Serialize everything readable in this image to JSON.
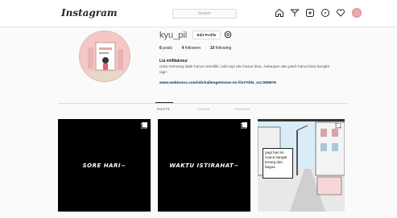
{
  "app": {
    "logo": "Instagram",
    "search_placeholder": "Search"
  },
  "nav_icons": [
    "home-icon",
    "direct-icon",
    "new-post-icon",
    "explore-icon",
    "activity-heart-icon",
    "profile-avatar"
  ],
  "profile": {
    "username": "kyu_pil",
    "edit_label": "Edit Profile",
    "posts_count": "6",
    "posts_label": "posts",
    "followers_count": "4",
    "followers_label": "followers",
    "following_count": "10",
    "following_label": "following",
    "full_name": "Lia milMakmur",
    "bio": "cinta memang tidak harus memiliki, sulit tapi aku harus bisa...kalaupun aku jatuh harus bisa bangkit lagi~",
    "link": "www.webtoons.com/id/challenge/move-on-/list?title_no=609676"
  },
  "tabs": {
    "posts": "POSTS",
    "saved": "SAVED",
    "tagged": "TAGGED"
  },
  "posts": [
    {
      "caption": "SORE HARI~"
    },
    {
      "caption": "WAKTU ISTIRAHAT~"
    },
    {
      "caption": "pagi hari ini cuaca sangat terang dan bagus."
    }
  ],
  "colors": {
    "link": "#003569",
    "avatar_bg": "#f3c8c7",
    "post_bg": "#000000"
  }
}
